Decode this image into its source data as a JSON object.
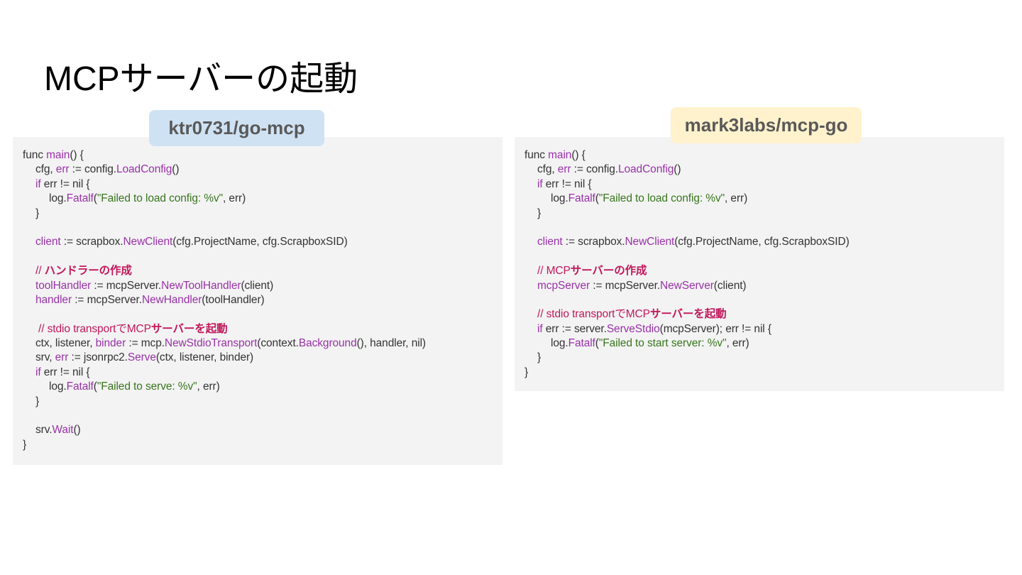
{
  "slide": {
    "title": "MCPサーバーの起動"
  },
  "left": {
    "badge": "ktr0731/go-mcp",
    "lines": {
      "l1_a": "func ",
      "l1_b": "main",
      "l1_c": "() {",
      "l2_a": "cfg, ",
      "l2_b": "err",
      "l2_c": " := config.",
      "l2_d": "LoadConfig",
      "l2_e": "()",
      "l3_a": "if",
      "l3_b": " err != nil {",
      "l4_a": "log.",
      "l4_b": "Fatalf",
      "l4_c": "(",
      "l4_d": "\"Failed to load config: %v\"",
      "l4_e": ", err)",
      "l5": "}",
      "l7_a": "client",
      "l7_b": " := scrapbox.",
      "l7_c": "NewClient",
      "l7_d": "(cfg.ProjectName, cfg.ScrapboxSID)",
      "l9_a": "// ",
      "l9_b": "ハンドラーの作成",
      "l10_a": "toolHandler",
      "l10_b": " := mcpServer.",
      "l10_c": "NewToolHandler",
      "l10_d": "(client)",
      "l11_a": "handler",
      "l11_b": " := mcpServer.",
      "l11_c": "NewHandler",
      "l11_d": "(toolHandler)",
      "l13_a": "// stdio transportでMCP",
      "l13_b": "サーバーを起動",
      "l14_a": "ctx, listener, ",
      "l14_b": "binder",
      "l14_c": " := mcp.",
      "l14_d": "NewStdioTransport",
      "l14_e": "(context.",
      "l14_f": "Background",
      "l14_g": "(), handler, nil)",
      "l15_a": "srv, ",
      "l15_b": "err",
      "l15_c": " := jsonrpc2.",
      "l15_d": "Serve",
      "l15_e": "(ctx, listener, binder)",
      "l16_a": "if",
      "l16_b": " err != nil {",
      "l17_a": "log.",
      "l17_b": "Fatalf",
      "l17_c": "(",
      "l17_d": "\"Failed to serve: %v\"",
      "l17_e": ", err)",
      "l18": "}",
      "l20_a": "srv.",
      "l20_b": "Wait",
      "l20_c": "()",
      "l21": "}"
    }
  },
  "right": {
    "badge": "mark3labs/mcp-go",
    "lines": {
      "l1_a": "func ",
      "l1_b": "main",
      "l1_c": "() {",
      "l2_a": "cfg, ",
      "l2_b": "err",
      "l2_c": " := config.",
      "l2_d": "LoadConfig",
      "l2_e": "()",
      "l3_a": "if",
      "l3_b": " err != nil {",
      "l4_a": "log.",
      "l4_b": "Fatalf",
      "l4_c": "(",
      "l4_d": "\"Failed to load config: %v\"",
      "l4_e": ", err)",
      "l5": "}",
      "l7_a": "client",
      "l7_b": " := scrapbox.",
      "l7_c": "NewClient",
      "l7_d": "(cfg.ProjectName, cfg.ScrapboxSID)",
      "l9_a": "// MCP",
      "l9_b": "サーバーの作成",
      "l10_a": "mcpServer",
      "l10_b": " := mcpServer.",
      "l10_c": "NewServer",
      "l10_d": "(client)",
      "l12_a": "// stdio transportでMCP",
      "l12_b": "サーバーを起動",
      "l13_a": "if",
      "l13_b": " err := server.",
      "l13_c": "ServeStdio",
      "l13_d": "(mcpServer); err != nil {",
      "l14_a": "log.",
      "l14_b": "Fatalf",
      "l14_c": "(",
      "l14_d": "\"Failed to start server: %v\"",
      "l14_e": ", err)",
      "l15": "}",
      "l16": "}"
    }
  },
  "colors": {
    "panel_bg": "#f3f3f3",
    "badge_left_bg": "#cfe2f3",
    "badge_right_bg": "#fff2cc",
    "function_purple": "#9932a8",
    "string_green": "#38761d",
    "comment_red": "#c2185b",
    "text": "#333333"
  }
}
